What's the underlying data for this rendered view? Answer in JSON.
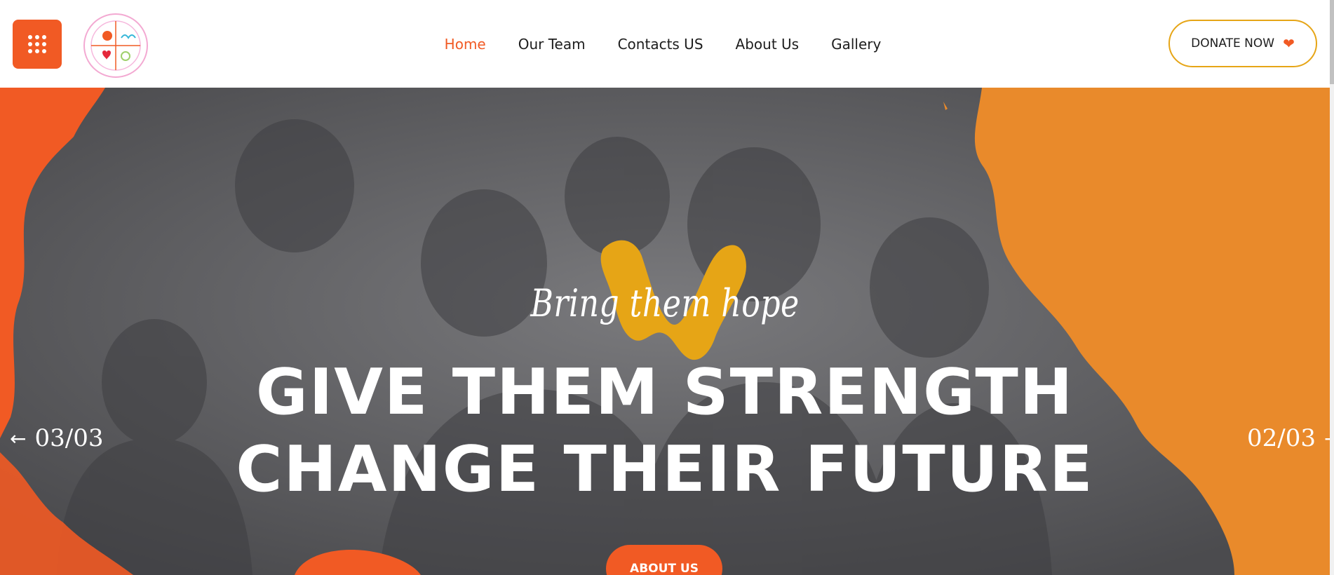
{
  "header": {
    "menu_icon": "grid-menu-icon",
    "logo_alt": "Community Vulnerability Reduction Foundation logo"
  },
  "nav": {
    "items": [
      {
        "label": "Home",
        "active": true
      },
      {
        "label": "Our Team",
        "active": false
      },
      {
        "label": "Contacts US",
        "active": false
      },
      {
        "label": "About Us",
        "active": false
      },
      {
        "label": "Gallery",
        "active": false
      }
    ]
  },
  "donate": {
    "label": "DONATE NOW",
    "icon": "heart-icon"
  },
  "hero": {
    "kicker": "Bring them hope",
    "headline_line1": "GIVE THEM STRENGTH",
    "headline_line2": "CHANGE THEIR FUTURE",
    "prev_counter": "03/03",
    "next_counter": "02/03",
    "cta_label": "ABOUT US"
  },
  "colors": {
    "accent": "#f15a24",
    "orange_right": "#e98a2b",
    "brush": "#e6a516",
    "donate_border": "#e6a516"
  }
}
